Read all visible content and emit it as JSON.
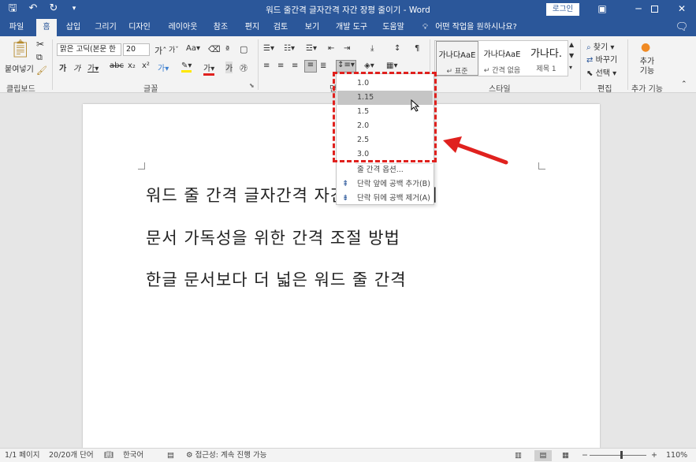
{
  "window": {
    "title": "워드 줄간격 글자간격 자간 장평 줄이기 - Word",
    "login_label": "로그인",
    "qat_icons": [
      "save-icon",
      "undo-icon",
      "redo-icon",
      "customize-icon"
    ]
  },
  "tabs": [
    "파일",
    "홈",
    "삽입",
    "그리기",
    "디자인",
    "레이아웃",
    "참조",
    "편지",
    "검토",
    "보기",
    "개발 도구",
    "도움말"
  ],
  "active_tab": "홈",
  "tell_me": "어떤 작업을 원하시나요?",
  "ribbon": {
    "clipboard": {
      "paste_label": "붙여넣기",
      "group_label": "클립보드"
    },
    "font": {
      "name": "맑은 고딕(본문 한",
      "size": "20",
      "group_label": "글꼴"
    },
    "paragraph": {
      "group_label": "단"
    },
    "styles": {
      "items": [
        {
          "preview": "가나다AaE",
          "name": "↵ 표준"
        },
        {
          "preview": "가나다AaE",
          "name": "↵ 간격 없음"
        },
        {
          "preview": "가나다.",
          "name": "제목 1"
        }
      ],
      "group_label": "스타일"
    },
    "editing": {
      "find": "찾기",
      "replace": "바꾸기",
      "select": "선택",
      "group_label": "편집"
    },
    "addins": {
      "label": "추가 기능",
      "group_label": "추가 기능"
    }
  },
  "line_spacing_menu": {
    "options": [
      "1.0",
      "1.15",
      "1.5",
      "2.0",
      "2.5",
      "3.0"
    ],
    "highlighted": "1.15",
    "more_options": "줄 간격 옵션...",
    "add_space_before": "단락 앞에 공백 추가(B)",
    "remove_space_after": "단락 뒤에 공백 제거(A)"
  },
  "document": {
    "lines": [
      "워드 줄 간격 글자간격 자간 장평 줄이기",
      "문서 가독성을 위한 간격 조절 방법",
      "한글 문서보다 더 넓은 워드 줄 간격"
    ]
  },
  "status": {
    "page": "1/1 페이지",
    "words": "20/20개 단어",
    "language": "한국어",
    "accessibility": "접근성: 계속 진행 가능",
    "zoom": "110%",
    "zoom_value": 110
  },
  "colors": {
    "brand": "#2b579a",
    "highlight_red": "#e0211e"
  }
}
